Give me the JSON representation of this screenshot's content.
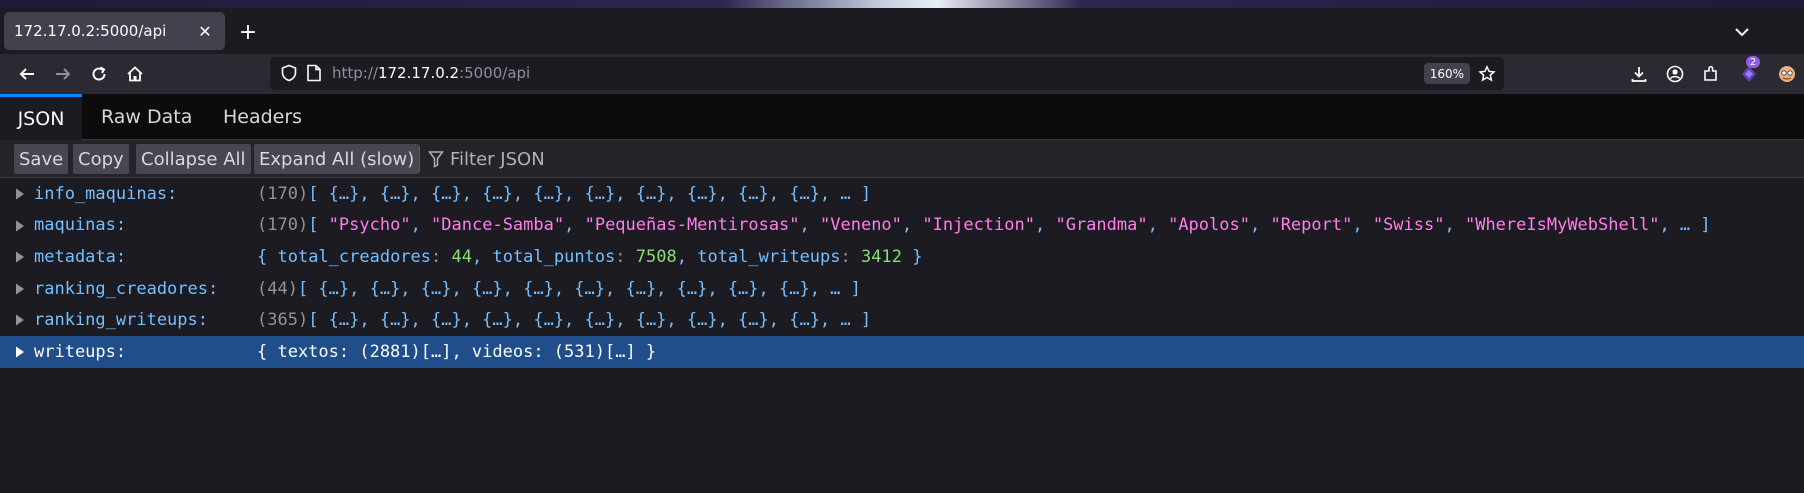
{
  "browser": {
    "tab_title": "172.17.0.2:5000/api",
    "url_scheme": "http://",
    "url_host": "172.17.0.2",
    "url_rest": ":5000/api",
    "zoom": "160%",
    "extension_badge": "2"
  },
  "viewer": {
    "tabs": [
      "JSON",
      "Raw Data",
      "Headers"
    ],
    "toolbar": {
      "save": "Save",
      "copy": "Copy",
      "collapse_all": "Collapse All",
      "expand_all": "Expand All (slow)",
      "filter_placeholder": "Filter JSON"
    },
    "rows": [
      {
        "key": "info_maquinas:",
        "count": "(170)",
        "summary": "[ {…}, {…}, {…}, {…}, {…}, {…}, {…}, {…}, {…}, {…}, … ]"
      },
      {
        "key": "maquinas:",
        "count": "(170)",
        "strings": [
          "\"Psycho\"",
          "\"Dance-Samba\"",
          "\"Pequeñas-Mentirosas\"",
          "\"Veneno\"",
          "\"Injection\"",
          "\"Grandma\"",
          "\"Apolos\"",
          "\"Report\"",
          "\"Swiss\"",
          "\"WhereIsMyWebShell\""
        ]
      },
      {
        "key": "metadata:",
        "pairs": [
          {
            "k": "total_creadores",
            "v": "44"
          },
          {
            "k": "total_puntos",
            "v": "7508"
          },
          {
            "k": "total_writeups",
            "v": "3412"
          }
        ]
      },
      {
        "key": "ranking_creadores:",
        "count": "(44)",
        "summary": "[ {…}, {…}, {…}, {…}, {…}, {…}, {…}, {…}, {…}, {…}, … ]"
      },
      {
        "key": "ranking_writeups:",
        "count": "(365)",
        "summary": "[ {…}, {…}, {…}, {…}, {…}, {…}, {…}, {…}, {…}, {…}, … ]"
      },
      {
        "key": "writeups:",
        "summary": "{ textos: (2881)[…], videos: (531)[…] }"
      }
    ]
  }
}
